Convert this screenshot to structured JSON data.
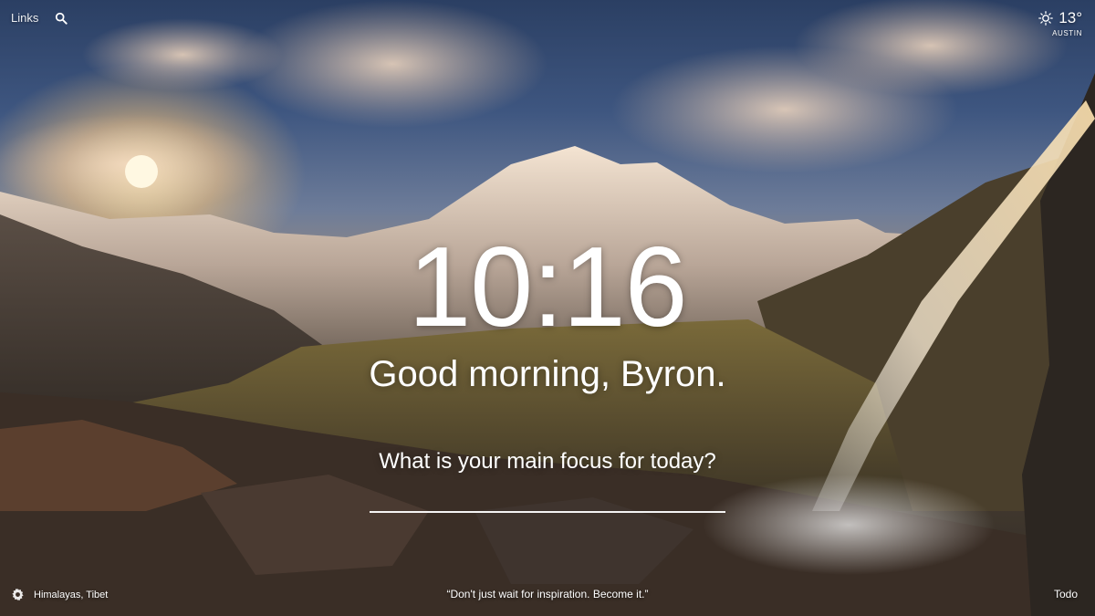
{
  "topbar": {
    "links_label": "Links",
    "search_icon": "search-icon"
  },
  "weather": {
    "icon": "sun-icon",
    "temperature": "13°",
    "location": "AUSTIN"
  },
  "main": {
    "time": "10:16",
    "greeting": "Good morning, Byron.",
    "focus_question": "What is your main focus for today?",
    "focus_value": ""
  },
  "footer": {
    "settings_icon": "gear-icon",
    "photo_location": "Himalayas, Tibet",
    "quote": "“Don't just wait for inspiration. Become it.”",
    "todo_label": "Todo"
  },
  "colors": {
    "text": "#ffffff",
    "sky_top": "#2b3f63",
    "sun_glow": "#ffe9b0",
    "ground": "#2f2a24"
  }
}
